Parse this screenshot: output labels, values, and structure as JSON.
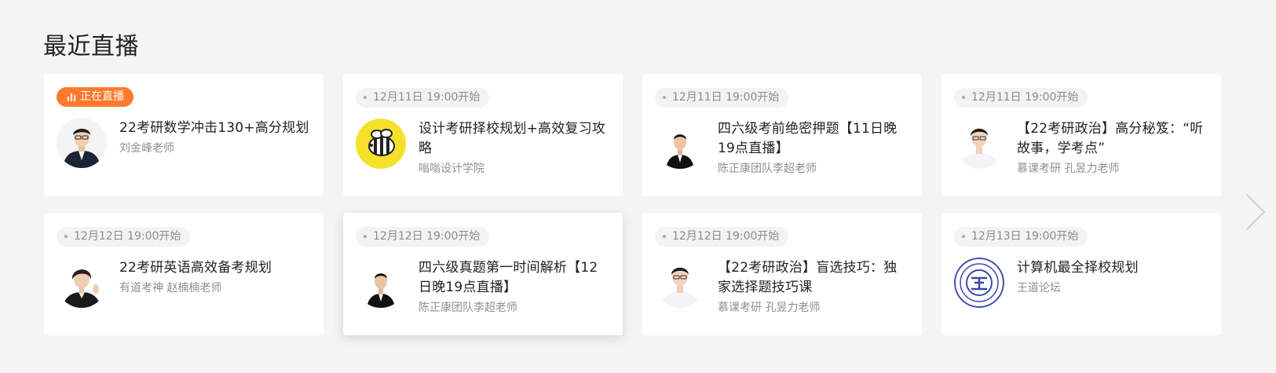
{
  "section": {
    "title": "最近直播"
  },
  "cards": [
    {
      "status": "live",
      "tag": "正在直播",
      "title": "22考研数学冲击130+高分规划",
      "subtitle": "刘金峰老师",
      "avatar": "teacher-avatar"
    },
    {
      "status": "upcoming",
      "tag": "12月11日 19:00开始",
      "title": "设计考研择校规划+高效复习攻略",
      "subtitle": "嗡嗡设计学院",
      "avatar": "bee-logo"
    },
    {
      "status": "upcoming",
      "tag": "12月11日 19:00开始",
      "title": "四六级考前绝密押题【11日晚19点直播】",
      "subtitle": "陈正康团队李超老师",
      "avatar": "teacher-avatar"
    },
    {
      "status": "upcoming",
      "tag": "12月11日 19:00开始",
      "title": "【22考研政治】高分秘笈：“听故事，学考点”",
      "subtitle": "慕课考研 孔昱力老师",
      "avatar": "teacher-avatar"
    },
    {
      "status": "upcoming",
      "tag": "12月12日 19:00开始",
      "title": "22考研英语高效备考规划",
      "subtitle": "有道考神 赵楠楠老师",
      "avatar": "teacher-avatar"
    },
    {
      "status": "upcoming",
      "tag": "12月12日 19:00开始",
      "title": "四六级真题第一时间解析【12日晚19点直播】",
      "subtitle": "陈正康团队李超老师",
      "avatar": "teacher-avatar"
    },
    {
      "status": "upcoming",
      "tag": "12月12日 19:00开始",
      "title": "【22考研政治】盲选技巧：独家选择题技巧课",
      "subtitle": "慕课考研 孔昱力老师",
      "avatar": "teacher-avatar"
    },
    {
      "status": "upcoming",
      "tag": "12月13日 19:00开始",
      "title": "计算机最全择校规划",
      "subtitle": "王道论坛",
      "avatar": "wangdao-logo"
    }
  ],
  "colors": {
    "live": "#ff7a2c",
    "time_bg": "#f3f3f3",
    "bee_yellow": "#f5e12a"
  },
  "nav": {
    "next_icon": "chevron-right-icon"
  }
}
